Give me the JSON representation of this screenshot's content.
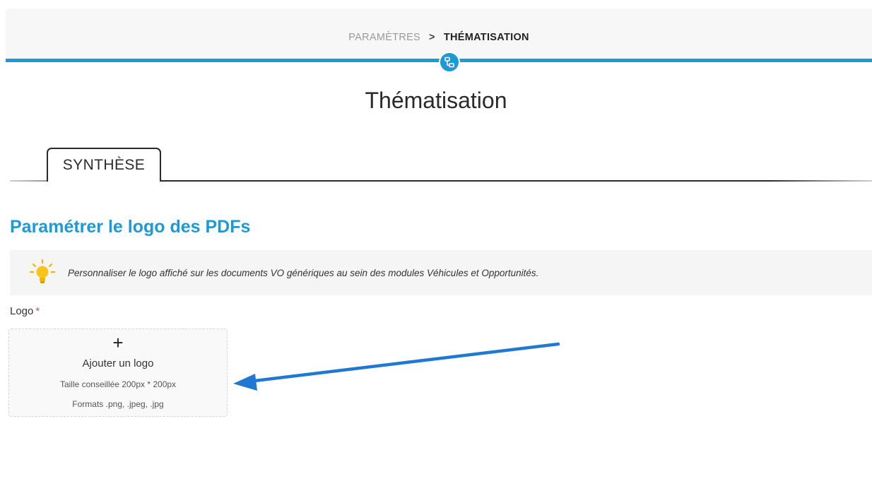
{
  "breadcrumb": {
    "parent": "PARAMÈTRES",
    "separator": ">",
    "current": "THÉMATISATION"
  },
  "header": {
    "module_icon": "network-icon",
    "accent_color": "#1d9ad6"
  },
  "page": {
    "title": "Thématisation"
  },
  "tabs": [
    {
      "label": "SYNTHÈSE",
      "active": true
    }
  ],
  "section": {
    "title": "Paramétrer le logo des PDFs",
    "info_icon": "lightbulb-icon",
    "info_text": "Personnaliser le logo affiché sur les documents VO génériques au sein des modules Véhicules et Opportunités."
  },
  "logo_field": {
    "label": "Logo",
    "required_marker": "*",
    "upload": {
      "plus": "+",
      "label": "Ajouter un logo",
      "size_hint": "Taille conseillée 200px * 200px",
      "formats_hint": "Formats .png, .jpeg, .jpg"
    }
  },
  "annotation": {
    "type": "arrow",
    "color": "#1f78d1"
  }
}
